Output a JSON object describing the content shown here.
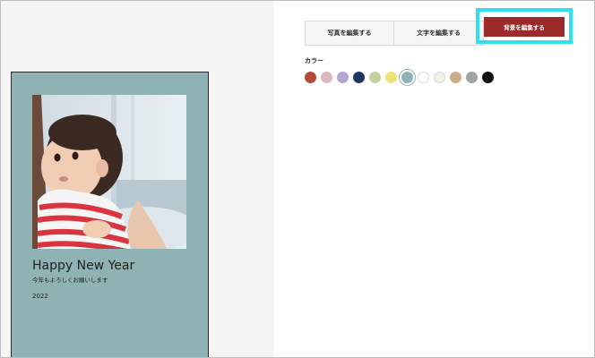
{
  "card": {
    "title": "Happy New Year",
    "subtitle": "今年もよろしくお願いします",
    "year": "2022",
    "background": "#8fb3b4"
  },
  "tabs": {
    "edit_photo": "写真を編集する",
    "edit_text": "文字を編集する",
    "edit_background": "背景を編集する"
  },
  "colors": {
    "label": "カラー",
    "selected_index": 6,
    "swatches": [
      "#b34a38",
      "#dbb8c0",
      "#b3a8cf",
      "#1f3760",
      "#c3d19f",
      "#ebe27a",
      "#8fb3b4",
      "#ffffff",
      "#f3f1e6",
      "#c8ae86",
      "#a3a3a3",
      "#111111"
    ]
  },
  "accent": "#9b2b2b",
  "highlight": "#30e0f0"
}
